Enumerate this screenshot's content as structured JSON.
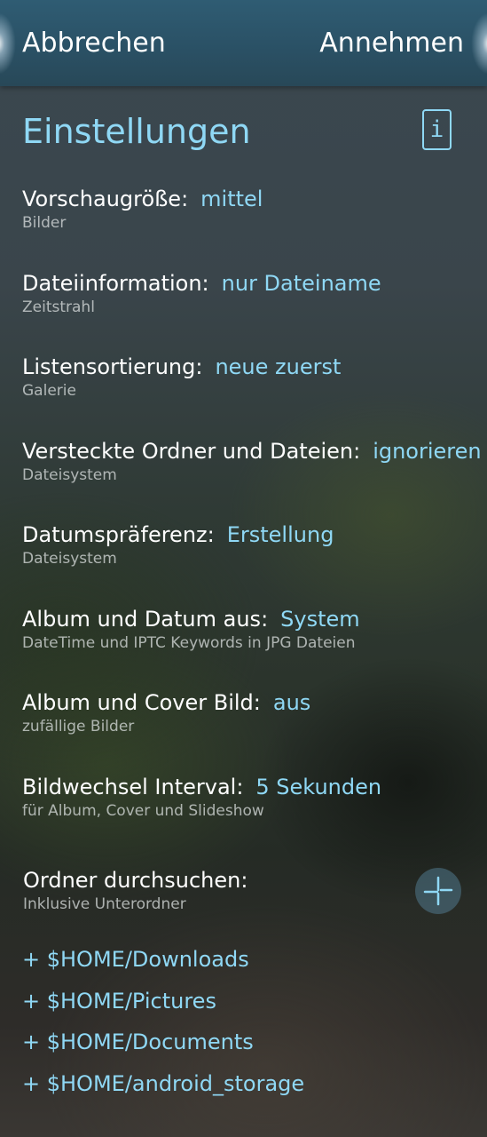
{
  "header": {
    "cancel_label": "Abbrechen",
    "accept_label": "Annehmen"
  },
  "page": {
    "title": "Einstellungen",
    "info_icon_glyph": "i"
  },
  "settings": [
    {
      "label": "Vorschaugröße:",
      "value": "mittel",
      "subtitle": "Bilder"
    },
    {
      "label": "Dateiinformation:",
      "value": "nur Dateiname",
      "subtitle": "Zeitstrahl"
    },
    {
      "label": "Listensortierung:",
      "value": "neue zuerst",
      "subtitle": "Galerie"
    },
    {
      "label": "Versteckte Ordner und Dateien:",
      "value": "ignorieren",
      "subtitle": "Dateisystem"
    },
    {
      "label": "Datumspräferenz:",
      "value": "Erstellung",
      "subtitle": "Dateisystem"
    },
    {
      "label": "Album und Datum aus:",
      "value": "System",
      "subtitle": "DateTime und IPTC Keywords in JPG Dateien"
    },
    {
      "label": "Album und Cover Bild:",
      "value": "aus",
      "subtitle": "zufällige Bilder"
    },
    {
      "label": "Bildwechsel Interval:",
      "value": "5 Sekunden",
      "subtitle": "für Album, Cover und Slideshow"
    }
  ],
  "folders": {
    "title": "Ordner durchsuchen:",
    "subtitle": "Inklusive Unterordner",
    "items": [
      "+ $HOME/Downloads",
      "+ $HOME/Pictures",
      "+ $HOME/Documents",
      "+ $HOME/android_storage"
    ]
  },
  "colors": {
    "accent": "#8fd8f5",
    "header_bg": "#2f5c73",
    "text": "#ffffff"
  },
  "icons": {
    "info": "info-icon",
    "add_folder": "add-folder-icon"
  }
}
